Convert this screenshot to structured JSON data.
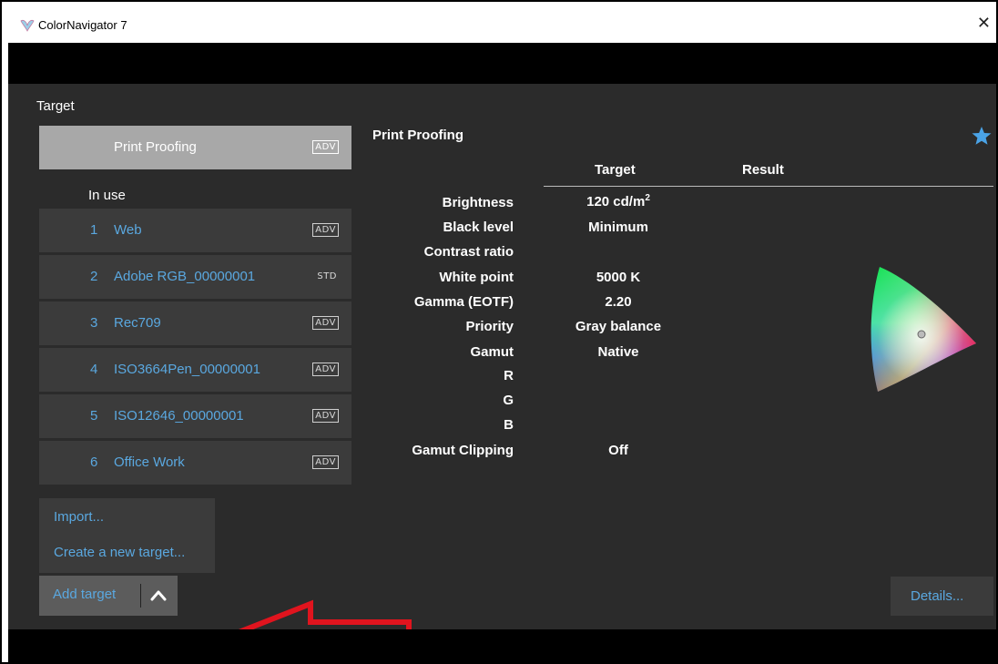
{
  "window": {
    "title": "ColorNavigator 7",
    "close_glyph": "✕"
  },
  "sidebar": {
    "heading": "Target",
    "current": {
      "label": "Print Proofing",
      "badge": "ADV"
    },
    "in_use_heading": "In use",
    "items": [
      {
        "num": "1",
        "name": "Web",
        "badge": "ADV"
      },
      {
        "num": "2",
        "name": "Adobe RGB_00000001",
        "badge": "STD"
      },
      {
        "num": "3",
        "name": "Rec709",
        "badge": "ADV"
      },
      {
        "num": "4",
        "name": "ISO3664Pen_00000001",
        "badge": "ADV"
      },
      {
        "num": "5",
        "name": "ISO12646_00000001",
        "badge": "ADV"
      },
      {
        "num": "6",
        "name": "Office Work",
        "badge": "ADV"
      }
    ],
    "menu": {
      "import": "Import...",
      "create": "Create a new target..."
    },
    "add_target": {
      "label": "Add target"
    }
  },
  "main": {
    "title": "Print Proofing",
    "columns": {
      "target": "Target",
      "result": "Result"
    },
    "properties": {
      "brightness": {
        "label": "Brightness",
        "value": "120 cd/m",
        "value_sup": "2"
      },
      "black_level": {
        "label": "Black level",
        "value": "Minimum"
      },
      "contrast_ratio": {
        "label": "Contrast ratio",
        "value": ""
      },
      "white_point": {
        "label": "White point",
        "value": "5000 K"
      },
      "gamma": {
        "label": "Gamma (EOTF)",
        "value": "2.20"
      },
      "priority": {
        "label": "Priority",
        "value": "Gray balance"
      },
      "gamut": {
        "label": "Gamut",
        "value": "Native"
      },
      "r": {
        "label": "R",
        "value": ""
      },
      "g": {
        "label": "G",
        "value": ""
      },
      "b": {
        "label": "B",
        "value": ""
      },
      "gamut_clipping": {
        "label": "Gamut Clipping",
        "value": "Off"
      }
    },
    "details_label": "Details..."
  },
  "colors": {
    "accent": "#5aa8e0",
    "panel": "#2b2b2b",
    "item": "#3b3b3b",
    "annotation": "#e0141e"
  },
  "icons": {
    "app": "colornavigator-logo-icon",
    "star": "star-icon",
    "chevron": "chevron-up-icon",
    "close": "close-icon"
  }
}
